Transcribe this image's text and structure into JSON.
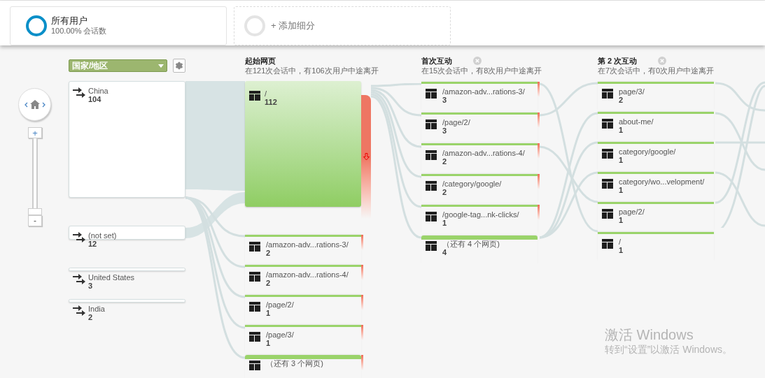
{
  "segment": {
    "name": "所有用户",
    "share": "100.00% 会话数"
  },
  "add_segment": {
    "label": "+ 添加细分"
  },
  "zoom": {
    "in": "+",
    "out": "-",
    "level": 0
  },
  "dimension": {
    "label": "国家/地区"
  },
  "countries": [
    {
      "name": "China",
      "count": "104",
      "kind": "large"
    },
    {
      "name": "(not set)",
      "count": "12",
      "kind": "medium"
    },
    {
      "name": "United States",
      "count": "3",
      "kind": "small"
    },
    {
      "name": "India",
      "count": "2",
      "kind": "small"
    }
  ],
  "steps": [
    {
      "title": "起始网页",
      "subtitle": "在121次会话中，有106次用户中途离开",
      "removable": false,
      "nodes": [
        {
          "label": "/",
          "count": "112",
          "kind": "large",
          "dropoff": true
        },
        {
          "label": "/amazon-adv...rations-3/",
          "count": "2",
          "kind": "page",
          "dropoff": true
        },
        {
          "label": "/amazon-adv...rations-4/",
          "count": "2",
          "kind": "page",
          "dropoff": true
        },
        {
          "label": "/page/2/",
          "count": "1",
          "kind": "page",
          "dropoff": true
        },
        {
          "label": "/page/3/",
          "count": "1",
          "kind": "page",
          "dropoff": true
        },
        {
          "label": "（还有 3 个网页)",
          "kind": "more",
          "dropoff": true
        }
      ]
    },
    {
      "title": "首次互动",
      "subtitle": "在15次会话中，有8次用户中途离开",
      "removable": true,
      "nodes": [
        {
          "label": "/amazon-adv...rations-3/",
          "count": "3",
          "kind": "page",
          "dropoff": true
        },
        {
          "label": "/page/2/",
          "count": "3",
          "kind": "page",
          "dropoff": true
        },
        {
          "label": "/amazon-adv...rations-4/",
          "count": "2",
          "kind": "page",
          "dropoff": true
        },
        {
          "label": "/category/google/",
          "count": "2",
          "kind": "page",
          "dropoff": true
        },
        {
          "label": "/google-tag...nk-clicks/",
          "count": "1",
          "kind": "page",
          "dropoff": true
        },
        {
          "label": "（还有 4 个网页)",
          "count": "4",
          "kind": "more",
          "dropoff": false
        }
      ]
    },
    {
      "title": "第 2 次互动",
      "subtitle": "在7次会话中，有0次用户中途离开",
      "removable": true,
      "nodes": [
        {
          "label": "page/3/",
          "count": "2",
          "kind": "page",
          "dropoff": false
        },
        {
          "label": "about-me/",
          "count": "1",
          "kind": "page",
          "dropoff": false
        },
        {
          "label": "category/google/",
          "count": "1",
          "kind": "page",
          "dropoff": false
        },
        {
          "label": "category/wo...velopment/",
          "count": "1",
          "kind": "page",
          "dropoff": false
        },
        {
          "label": "page/2/",
          "count": "1",
          "kind": "page",
          "dropoff": false
        },
        {
          "label": "/",
          "count": "1",
          "kind": "page",
          "dropoff": false
        }
      ]
    }
  ],
  "os_notice": {
    "title": "激活 Windows",
    "subtitle": "转到“设置”以激活 Windows。"
  }
}
